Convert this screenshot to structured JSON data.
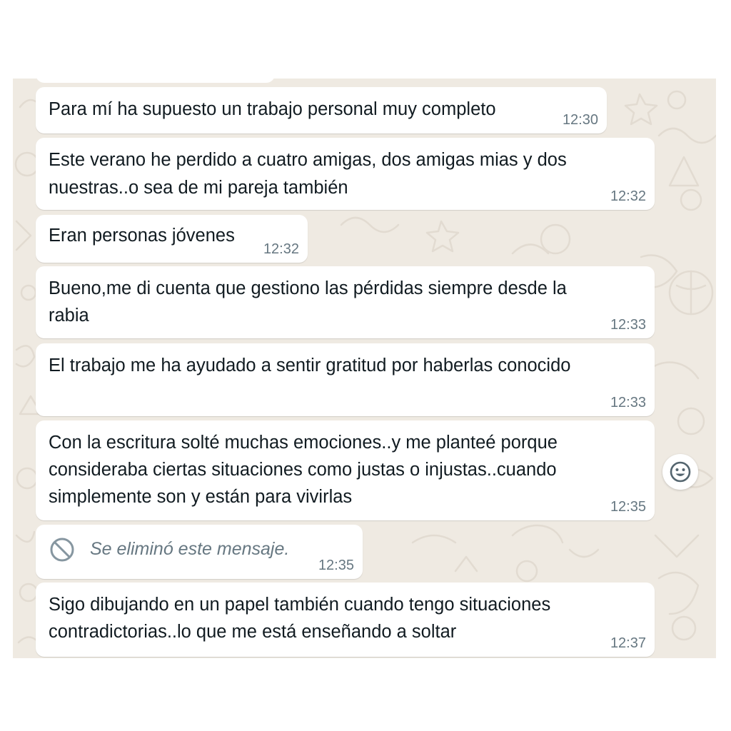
{
  "messages": [
    {
      "text_lines": [
        "Para mí ha supuesto un trabajo personal muy completo"
      ],
      "time": "12:30"
    },
    {
      "text_lines": [
        "Este verano he perdido a cuatro amigas, dos amigas mias y dos",
        "nuestras..o sea de mi pareja también"
      ],
      "time": "12:32"
    },
    {
      "text_lines": [
        "Eran personas jóvenes"
      ],
      "time": "12:32"
    },
    {
      "text_lines": [
        "Bueno,me di cuenta que gestiono las pérdidas siempre desde la",
        "rabia"
      ],
      "time": "12:33"
    },
    {
      "text_lines": [
        "El trabajo me ha ayudado a sentir gratitud por haberlas conocido"
      ],
      "time": "12:33"
    },
    {
      "text_lines": [
        "Con la escritura solté muchas emociones..y me planteé porque",
        "consideraba ciertas situaciones como justas o injustas..cuando",
        "simplemente son y están para vivirlas"
      ],
      "time": "12:35"
    },
    {
      "deleted": true,
      "text": "Se eliminó este mensaje.",
      "time": "12:35",
      "icon": "ban-icon"
    },
    {
      "text_lines": [
        "Sigo dibujando en un papel también cuando tengo situaciones",
        "contradictorias..lo que me está enseñando a soltar"
      ],
      "time": "12:37"
    }
  ],
  "react_button": {
    "icon": "smiley-icon"
  },
  "colors": {
    "chat_background": "#efeae2",
    "bubble": "#ffffff",
    "text": "#111b21",
    "meta": "#667781"
  }
}
